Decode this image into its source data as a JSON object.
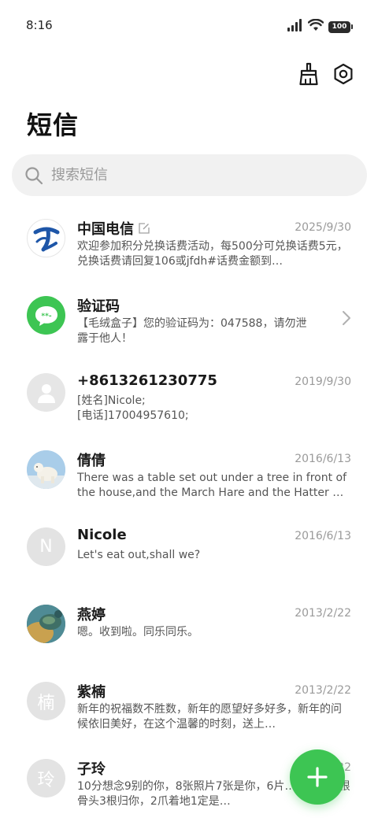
{
  "status_bar": {
    "time": "8:16",
    "battery": "100"
  },
  "header": {
    "title": "短信"
  },
  "search": {
    "placeholder": "搜索短信"
  },
  "conversations": [
    {
      "name": "中国电信",
      "date": "2025/9/30",
      "preview": "欢迎参加积分兑换话费活动，每500分可兑换话费5元，兑换话费请回复106或jfdh#话费金额到…",
      "avatar": "telecom-logo"
    },
    {
      "name": "验证码",
      "date": "",
      "preview": "【毛绒盒子】您的验证码为：047588，请勿泄露于他人！",
      "avatar": "chat-bubble"
    },
    {
      "name": "+8613261230775",
      "date": "2019/9/30",
      "preview": "[姓名]Nicole;\n[电话]17004957610;",
      "avatar": "person"
    },
    {
      "name": "倩倩",
      "date": "2016/6/13",
      "preview": "There was a table set out under a tree in front of the house,and the March Hare and the Hatter wer…",
      "avatar": "polar-bear-photo"
    },
    {
      "name": "Nicole",
      "date": "2016/6/13",
      "preview": "Let's eat out,shall we?",
      "avatar": "N"
    },
    {
      "name": "燕婷",
      "date": "2013/2/22",
      "preview": "嗯。收到啦。同乐同乐。",
      "avatar": "turtle-photo"
    },
    {
      "name": "紫楠",
      "date": "2013/2/22",
      "preview": "新年的祝福数不胜数，新年的愿望好多好多，新年的问候依旧美好，在这个温馨的时刻，送上…",
      "avatar": "楠"
    },
    {
      "name": "子玲",
      "date": "2013/2/22",
      "preview": "10分想念9别的你，8张照片7张是你，6片… 像你，4根骨头3根归你，2爪着地1定是…",
      "avatar": "玲"
    }
  ],
  "colors": {
    "accent": "#3dc553",
    "telecom_blue": "#1e56a8"
  }
}
